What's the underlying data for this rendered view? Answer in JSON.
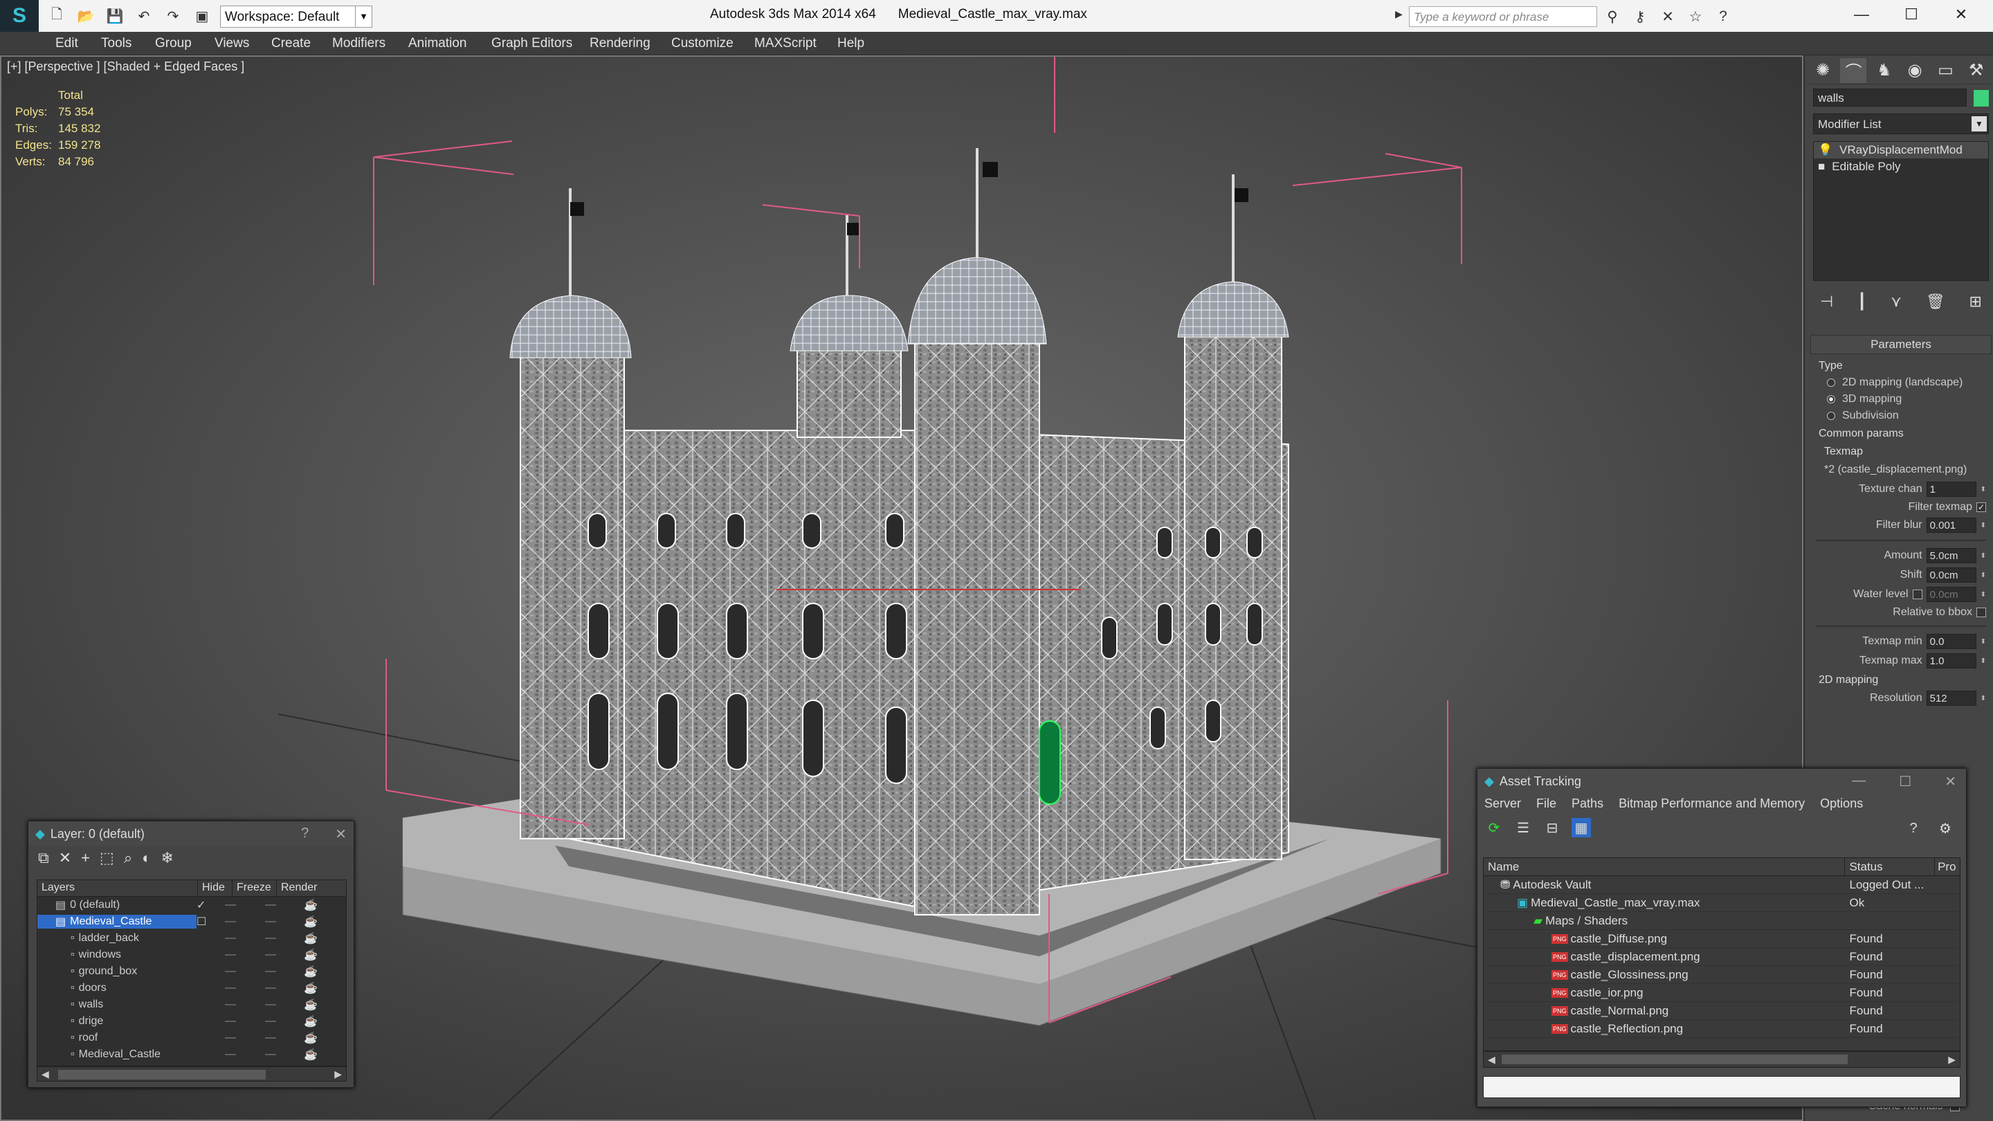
{
  "app": {
    "title": "Autodesk 3ds Max  2014 x64",
    "file": "Medieval_Castle_max_vray.max",
    "workspace": "Workspace: Default",
    "search_placeholder": "Type a keyword or phrase"
  },
  "menu": [
    "Edit",
    "Tools",
    "Group",
    "Views",
    "Create",
    "Modifiers",
    "Animation",
    "Graph Editors",
    "Rendering",
    "Customize",
    "MAXScript",
    "Help"
  ],
  "viewport": {
    "label": "[+] [Perspective ] [Shaded + Edged Faces ]",
    "stats": {
      "header": "Total",
      "rows": [
        {
          "k": "Polys:",
          "v": "75 354"
        },
        {
          "k": "Tris:",
          "v": "145 832"
        },
        {
          "k": "Edges:",
          "v": "159 278"
        },
        {
          "k": "Verts:",
          "v": "84 796"
        }
      ]
    }
  },
  "command_panel": {
    "object_name": "walls",
    "object_color": "#3dd27b",
    "modifier_list": "Modifier List",
    "stack": [
      "VRayDisplacementMod",
      "Editable Poly"
    ],
    "rollout_title": "Parameters",
    "type_group": "Type",
    "types": [
      "2D mapping (landscape)",
      "3D mapping",
      "Subdivision"
    ],
    "selected_type": 1,
    "common_params": "Common params",
    "texmap_label": "Texmap",
    "texmap_value": "*2 (castle_displacement.png)",
    "texture_chan_label": "Texture chan",
    "texture_chan": "1",
    "filter_texmap_label": "Filter texmap",
    "filter_blur_label": "Filter blur",
    "filter_blur": "0.001",
    "amount_label": "Amount",
    "amount": "5.0cm",
    "shift_label": "Shift",
    "shift": "0.0cm",
    "water_level_label": "Water level",
    "water_level": "0.0cm",
    "relative_bbox_label": "Relative to bbox",
    "texmap_min_label": "Texmap min",
    "texmap_min": "0.0",
    "texmap_max_label": "Texmap max",
    "texmap_max": "1.0",
    "mapping2d_label": "2D mapping",
    "resolution_label": "Resolution",
    "resolution": "512",
    "cache_normals": "Cache normals"
  },
  "layer_window": {
    "title": "Layer: 0 (default)",
    "help": "?",
    "close": "✕",
    "columns": [
      "Layers",
      "Hide",
      "Freeze",
      "Render"
    ],
    "layers": [
      {
        "name": "0 (default)",
        "indent": 1,
        "checked": true
      },
      {
        "name": "Medieval_Castle",
        "indent": 1,
        "selected": true
      },
      {
        "name": "ladder_back",
        "indent": 2
      },
      {
        "name": "windows",
        "indent": 2
      },
      {
        "name": "ground_box",
        "indent": 2
      },
      {
        "name": "doors",
        "indent": 2
      },
      {
        "name": "walls",
        "indent": 2
      },
      {
        "name": "drige",
        "indent": 2
      },
      {
        "name": "roof",
        "indent": 2
      },
      {
        "name": "Medieval_Castle",
        "indent": 2
      }
    ]
  },
  "asset_window": {
    "title": "Asset Tracking",
    "menu": [
      "Server",
      "File",
      "Paths",
      "Bitmap Performance and Memory",
      "Options"
    ],
    "columns": [
      "Name",
      "Status",
      "Pro"
    ],
    "rows": [
      {
        "name": "Autodesk Vault",
        "status": "Logged Out ...",
        "indent": 0,
        "icon": "vault"
      },
      {
        "name": "Medieval_Castle_max_vray.max",
        "status": "Ok",
        "indent": 1,
        "icon": "max"
      },
      {
        "name": "Maps / Shaders",
        "status": "",
        "indent": 2,
        "icon": "folder"
      },
      {
        "name": "castle_Diffuse.png",
        "status": "Found",
        "indent": 3,
        "icon": "png"
      },
      {
        "name": "castle_displacement.png",
        "status": "Found",
        "indent": 3,
        "icon": "png"
      },
      {
        "name": "castle_Glossiness.png",
        "status": "Found",
        "indent": 3,
        "icon": "png"
      },
      {
        "name": "castle_ior.png",
        "status": "Found",
        "indent": 3,
        "icon": "png"
      },
      {
        "name": "castle_Normal.png",
        "status": "Found",
        "indent": 3,
        "icon": "png"
      },
      {
        "name": "castle_Reflection.png",
        "status": "Found",
        "indent": 3,
        "icon": "png"
      }
    ]
  }
}
